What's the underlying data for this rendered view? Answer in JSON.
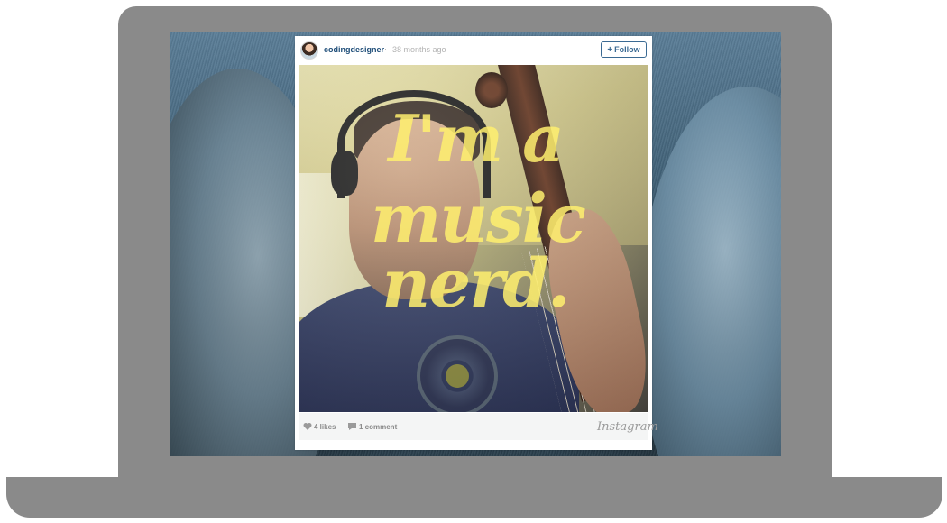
{
  "post": {
    "username": "codingdesigner",
    "separator": "·",
    "time_ago": "38 months ago",
    "follow_label": "Follow",
    "follow_icon": "plus-icon"
  },
  "photo": {
    "overlay_line1": "I'm a",
    "overlay_line2": "music",
    "overlay_line3": "nerd."
  },
  "footer": {
    "likes": "4 likes",
    "comments": "1 comment",
    "brand": "Instagram",
    "like_icon": "heart-icon",
    "comment_icon": "speech-bubble-icon"
  },
  "colors": {
    "laptop_frame": "#8a8a8a",
    "link_blue": "#1f4e79",
    "overlay_yellow": "#fff06e"
  }
}
